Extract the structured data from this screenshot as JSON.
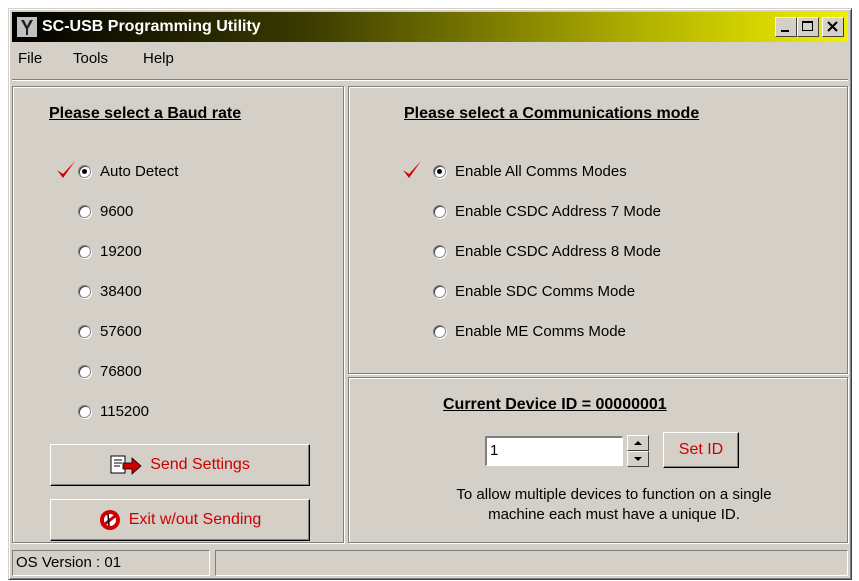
{
  "window": {
    "title": "SC-USB Programming Utility"
  },
  "menu": {
    "file": "File",
    "tools": "Tools",
    "help": "Help"
  },
  "baud": {
    "title": "Please select a Baud rate",
    "selected": "Auto Detect",
    "options": [
      "Auto Detect",
      "9600",
      "19200",
      "38400",
      "57600",
      "76800",
      "115200"
    ]
  },
  "comms": {
    "title": "Please select a Communications mode",
    "selected": "Enable All Comms Modes",
    "options": [
      "Enable All Comms Modes",
      "Enable CSDC Address 7 Mode",
      "Enable CSDC Address 8 Mode",
      "Enable SDC Comms Mode",
      "Enable ME Comms Mode"
    ]
  },
  "buttons": {
    "send": "Send Settings",
    "exit": "Exit w/out Sending",
    "set_id": "Set ID"
  },
  "device": {
    "title": "Current Device ID = 00000001",
    "id_value": "1",
    "note_line1": "To allow multiple devices to function on a single",
    "note_line2": "machine each must have a unique ID."
  },
  "status": {
    "os_version": "OS Version : 01",
    "right": ""
  },
  "colors": {
    "button_text": "#cc0000",
    "check": "#cc0000"
  },
  "icons": {
    "title": "app-icon",
    "send": "send-arrow-icon",
    "exit": "no-entry-icon",
    "check": "checkmark-icon"
  }
}
